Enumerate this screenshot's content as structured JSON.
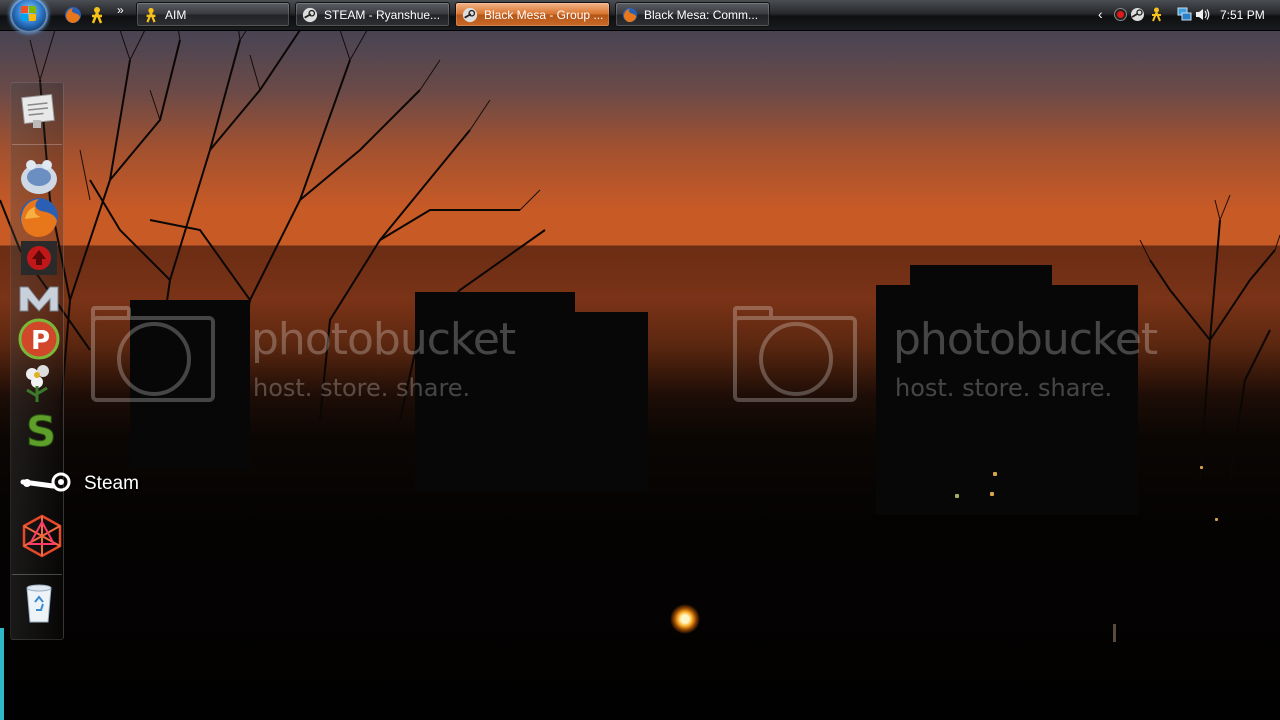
{
  "taskbar": {
    "start_button": "Start",
    "quick_launch": [
      {
        "name": "Firefox",
        "icon": "firefox-icon"
      },
      {
        "name": "AIM",
        "icon": "aim-icon"
      }
    ],
    "quick_launch_expand": "»",
    "tasks": [
      {
        "label": "AIM",
        "icon": "aim-icon",
        "active": false
      },
      {
        "label": "STEAM - Ryanshue...",
        "icon": "steam-icon",
        "active": false
      },
      {
        "label": "Black Mesa - Group ...",
        "icon": "steam-icon",
        "active": true
      },
      {
        "label": "Black Mesa: Comm...",
        "icon": "firefox-icon",
        "active": false
      }
    ],
    "tray": {
      "expand": "‹",
      "icons": [
        "record-icon",
        "steam-icon",
        "aim-icon",
        "network-icon",
        "volume-icon"
      ],
      "clock": "7:51 PM"
    }
  },
  "dock": {
    "items": [
      {
        "name": "Notes",
        "icon": "notes-icon"
      },
      {
        "name": "Folder",
        "icon": "folder-icon"
      },
      {
        "name": "Firefox",
        "icon": "firefox-icon"
      },
      {
        "name": "Upload",
        "icon": "upload-icon"
      },
      {
        "name": "M",
        "icon": "m-app-icon"
      },
      {
        "name": "P",
        "icon": "p-app-icon"
      },
      {
        "name": "Flower",
        "icon": "flower-icon"
      },
      {
        "name": "S",
        "icon": "s-app-icon"
      },
      {
        "name": "Steam",
        "icon": "steam-icon"
      },
      {
        "name": "Zune",
        "icon": "zune-icon"
      },
      {
        "name": "Recycle Bin",
        "icon": "recycle-bin-icon"
      }
    ],
    "hover_label": "Steam"
  },
  "watermark": {
    "title": "photobucket",
    "subtitle": "host. store. share."
  },
  "colors": {
    "sky_top": "#3b3f55",
    "sky_orange": "#c85a26",
    "active_task": "#d8742f"
  }
}
